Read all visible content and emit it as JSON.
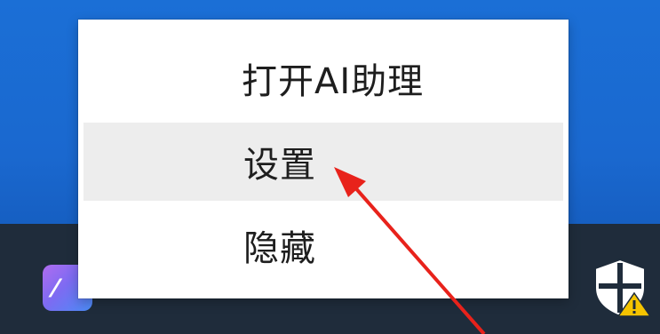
{
  "context_menu": {
    "items": [
      {
        "label": "打开AI助理"
      },
      {
        "label": "设置"
      },
      {
        "label": "隐藏"
      }
    ]
  },
  "tray": {
    "app_icon": "ai-assistant-app-icon",
    "security_icon": "windows-security-warning-shield-icon"
  },
  "annotation": {
    "arrow_color": "#e8221b"
  },
  "colors": {
    "desktop": "#1a68cf",
    "taskbar": "#1f2c3b",
    "menu_bg": "#ffffff",
    "hover_bg": "#ededed",
    "warning": "#f5c400"
  }
}
